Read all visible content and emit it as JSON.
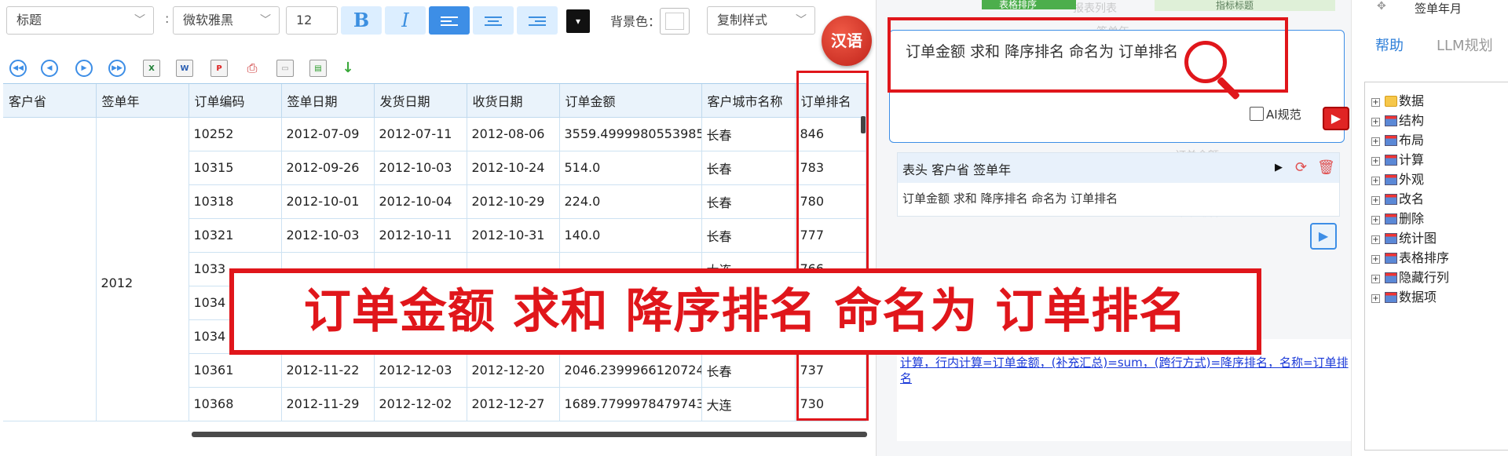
{
  "format_toolbar": {
    "style_select": "标题",
    "font_select": "微软雅黑",
    "font_size": "12",
    "bold": "B",
    "italic": "I",
    "separator": ":",
    "bg_color_label": "背景色：",
    "copy_style": "复制样式"
  },
  "language_button": "汉语",
  "table": {
    "headers": [
      "客户省",
      "签单年",
      "订单编码",
      "签单日期",
      "发货日期",
      "收货日期",
      "订单金额",
      "客户城市名称",
      "订单排名"
    ],
    "merged_year": "2012",
    "rows": [
      [
        "10252",
        "2012-07-09",
        "2012-07-11",
        "2012-08-06",
        "3559.4999980553985",
        "长春",
        "846"
      ],
      [
        "10315",
        "2012-09-26",
        "2012-10-03",
        "2012-10-24",
        "514.0",
        "长春",
        "783"
      ],
      [
        "10318",
        "2012-10-01",
        "2012-10-04",
        "2012-10-29",
        "224.0",
        "长春",
        "780"
      ],
      [
        "10321",
        "2012-10-03",
        "2012-10-11",
        "2012-10-31",
        "140.0",
        "长春",
        "777"
      ],
      [
        "1033",
        "",
        "",
        "",
        "",
        "大连",
        "766"
      ],
      [
        "1034",
        "",
        "",
        "",
        "",
        "",
        ""
      ],
      [
        "1034",
        "",
        "",
        "",
        "",
        "",
        ""
      ],
      [
        "10361",
        "2012-11-22",
        "2012-12-03",
        "2012-12-20",
        "2046.2399966120724",
        "长春",
        "737"
      ],
      [
        "10368",
        "2012-11-29",
        "2012-12-02",
        "2012-12-27",
        "1689.7799978479743",
        "大连",
        "730"
      ]
    ]
  },
  "assistant": {
    "command_text": "订单金额 求和 降序排名 命名为 订单排名",
    "ai_checkbox_label": "AI规范",
    "history_head": "表头 客户省 签单年",
    "history_body": "订单金额 求和 降序排名 命名为 订单排名",
    "result_link": "计算，行内计算=订单金额，(补充汇总)=sum，(跨行方式)=降序排名，名称=订单排名",
    "top_green_button": "表格排序",
    "top_tab_label": "指标标题"
  },
  "help": {
    "top_label": "签单年月",
    "tab_help": "帮助",
    "tab_llm": "LLM规划",
    "tree": [
      "数据",
      "结构",
      "布局",
      "计算",
      "外观",
      "改名",
      "删除",
      "统计图",
      "表格排序",
      "隐藏行列",
      "数据项"
    ]
  },
  "background_faint": [
    "签单年",
    "订单编码",
    "收货日期",
    "订单金额",
    "客户城市名称",
    "订单排名",
    "报表列表",
    "报表名称",
    "收货日期",
    "订单金额",
    "客户城市名称",
    "客户省"
  ],
  "banner_text": "订单金额 求和 降序排名 命名为 订单排名",
  "colors": {
    "accent": "#3d8ee6",
    "annotation_red": "#e0161b",
    "link_blue": "#1a39d8"
  }
}
